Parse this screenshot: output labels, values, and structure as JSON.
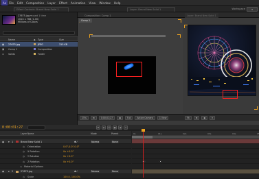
{
  "app": {
    "logo_text": "Ae",
    "menu": [
      "File",
      "Edit",
      "Composition",
      "Layer",
      "Effect",
      "Animation",
      "View",
      "Window",
      "Help"
    ],
    "workspace_label": "Workspace",
    "workspace_value": ""
  },
  "panel_tabs": [
    "Effect Controls: Brand New Solid 1",
    "Layer: Brand New Solid 1"
  ],
  "project": {
    "file_name": "27675.jpg",
    "used": "used 1 time",
    "dimensions": "1024 x 768 (1.00)",
    "colors": "Millions of Colors",
    "columns": {
      "name": "Name",
      "type": "Type",
      "size": "Size"
    },
    "items": [
      {
        "name": "27675.jpg",
        "type": "JPEG",
        "size": "315 KB",
        "label_color": "#c8a060",
        "selected": true
      },
      {
        "name": "Comp 1",
        "type": "Composition",
        "size": "",
        "label_color": "#7a7ad0",
        "selected": false
      },
      {
        "name": "Solids",
        "type": "Folder",
        "size": "",
        "label_color": "#d0b060",
        "selected": false
      }
    ],
    "bit_depth": "8 bpc"
  },
  "composition": {
    "tab_label": "Composition: Comp 1",
    "comp_tab": "Comp 1",
    "zoom": "25%",
    "timecode": "0;00;01;27",
    "quality": "Full",
    "camera": "Active Camera",
    "views": "1 View"
  },
  "footage": {
    "tab_label": "Layer: Brand New Solid 1",
    "zoom": "Fit"
  },
  "timeline": {
    "current_time": "0:00:01:27",
    "ruler_ticks": [
      "0s",
      "01s",
      "02s",
      "03s",
      "04s",
      "05s"
    ],
    "col_labels": {
      "layer_name": "Layer Name",
      "mode": "Mode",
      "parent": "Parent"
    },
    "rows": [
      {
        "kind": "layer",
        "num": "1",
        "name": "Brand New Solid 1",
        "mode": "Norma",
        "parent": "None"
      },
      {
        "kind": "prop",
        "name": "Orientation",
        "value": "0.0°,0.0°,0.0°"
      },
      {
        "kind": "prop",
        "name": "X Rotation",
        "value": "0x +0.0°"
      },
      {
        "kind": "prop",
        "name": "Y Rotation",
        "value": "0x +0.0°"
      },
      {
        "kind": "prop",
        "name": "Z Rotation",
        "value": "0x +0.0°"
      },
      {
        "kind": "group",
        "name": "Material Options",
        "value": ""
      },
      {
        "kind": "layer",
        "num": "2",
        "name": "27675.jpg",
        "mode": "Norma",
        "parent": "None"
      },
      {
        "kind": "prop",
        "name": "Scale",
        "value": "100.0, 100.0%"
      }
    ]
  },
  "colors": {
    "accent": "#e8a020",
    "selection": "#3d4e6e",
    "highlight_red": "#ff2020",
    "glow_blue": "#1e78ff"
  }
}
